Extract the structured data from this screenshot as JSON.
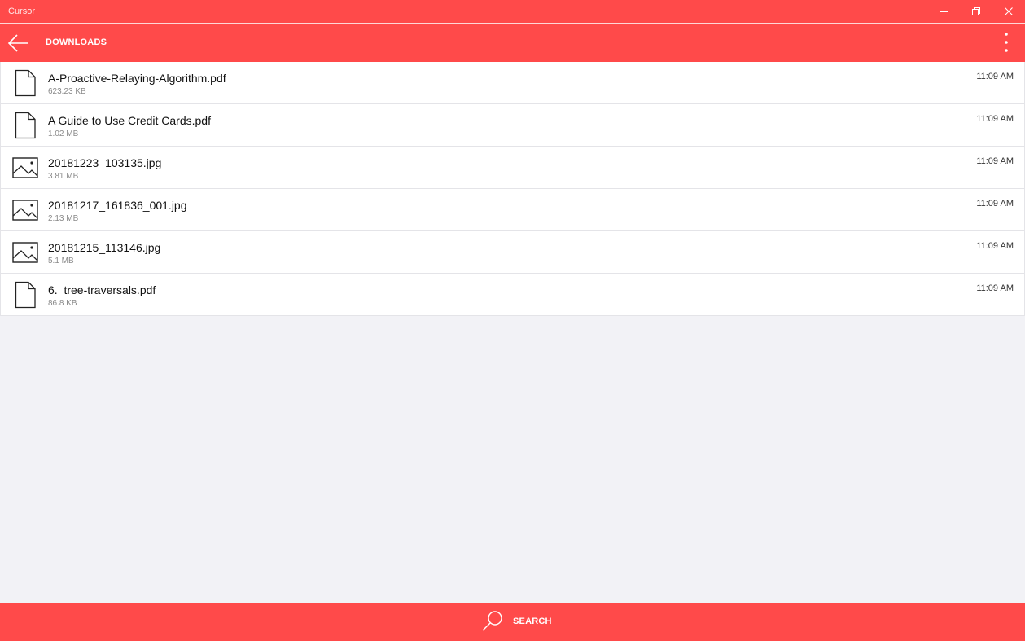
{
  "window": {
    "title": "Cursor",
    "minimize_icon": "minimize-icon",
    "restore_icon": "restore-icon",
    "close_icon": "close-icon"
  },
  "header": {
    "back_icon": "back-arrow-icon",
    "title": "DOWNLOADS",
    "more_icon": "more-vertical-icon"
  },
  "files": [
    {
      "name": "A-Proactive-Relaying-Algorithm.pdf",
      "size": "623.23 KB",
      "time": "11:09 AM",
      "icon": "document-icon"
    },
    {
      "name": "A Guide to Use Credit Cards.pdf",
      "size": "1.02 MB",
      "time": "11:09 AM",
      "icon": "document-icon"
    },
    {
      "name": "20181223_103135.jpg",
      "size": "3.81 MB",
      "time": "11:09 AM",
      "icon": "image-icon"
    },
    {
      "name": "20181217_161836_001.jpg",
      "size": "2.13 MB",
      "time": "11:09 AM",
      "icon": "image-icon"
    },
    {
      "name": "20181215_113146.jpg",
      "size": "5.1 MB",
      "time": "11:09 AM",
      "icon": "image-icon"
    },
    {
      "name": "6._tree-traversals.pdf",
      "size": "86.8 KB",
      "time": "11:09 AM",
      "icon": "document-icon"
    }
  ],
  "bottom_bar": {
    "search_icon": "search-icon",
    "search_label": "SEARCH"
  },
  "colors": {
    "accent": "#ff4a4a",
    "background": "#f2f2f6",
    "row_background": "#ffffff"
  }
}
